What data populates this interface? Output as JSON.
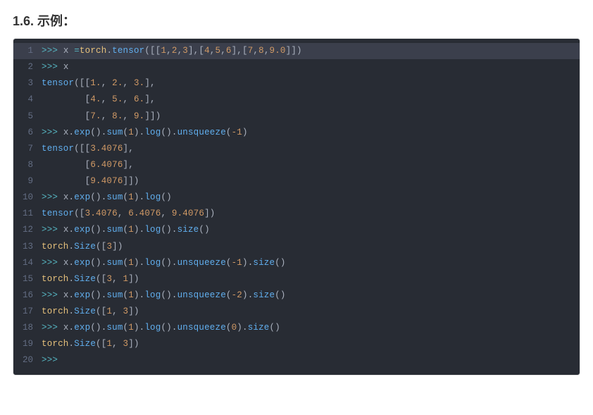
{
  "heading": "1.6. 示例：",
  "code": {
    "lineNumbers": [
      "1",
      "2",
      "3",
      "4",
      "5",
      "6",
      "7",
      "8",
      "9",
      "10",
      "11",
      "12",
      "13",
      "14",
      "15",
      "16",
      "17",
      "18",
      "19",
      "20"
    ],
    "lines": [
      {
        "highlight": true,
        "tokens": [
          [
            ">>> ",
            "t-op"
          ],
          [
            "x ",
            "t-id"
          ],
          [
            "=",
            "t-op"
          ],
          [
            "torch",
            "t-obj"
          ],
          [
            ".",
            "t-punc"
          ],
          [
            "tensor",
            "t-meth"
          ],
          [
            "([[",
            "t-punc"
          ],
          [
            "1",
            "t-num"
          ],
          [
            ",",
            "t-punc"
          ],
          [
            "2",
            "t-num"
          ],
          [
            ",",
            "t-punc"
          ],
          [
            "3",
            "t-num"
          ],
          [
            "],[",
            "t-punc"
          ],
          [
            "4",
            "t-num"
          ],
          [
            ",",
            "t-punc"
          ],
          [
            "5",
            "t-num"
          ],
          [
            ",",
            "t-punc"
          ],
          [
            "6",
            "t-num"
          ],
          [
            "],[",
            "t-punc"
          ],
          [
            "7",
            "t-num"
          ],
          [
            ",",
            "t-punc"
          ],
          [
            "8",
            "t-num"
          ],
          [
            ",",
            "t-punc"
          ],
          [
            "9.0",
            "t-num"
          ],
          [
            "]])",
            "t-punc"
          ]
        ]
      },
      {
        "highlight": false,
        "tokens": [
          [
            ">>> ",
            "t-op"
          ],
          [
            "x",
            "t-id"
          ]
        ]
      },
      {
        "highlight": false,
        "tokens": [
          [
            "tensor",
            "t-meth"
          ],
          [
            "([[",
            "t-punc"
          ],
          [
            "1.",
            "t-num"
          ],
          [
            ", ",
            "t-punc"
          ],
          [
            "2.",
            "t-num"
          ],
          [
            ", ",
            "t-punc"
          ],
          [
            "3.",
            "t-num"
          ],
          [
            "],",
            "t-punc"
          ]
        ]
      },
      {
        "highlight": false,
        "tokens": [
          [
            "        [",
            "t-punc"
          ],
          [
            "4.",
            "t-num"
          ],
          [
            ", ",
            "t-punc"
          ],
          [
            "5.",
            "t-num"
          ],
          [
            ", ",
            "t-punc"
          ],
          [
            "6.",
            "t-num"
          ],
          [
            "],",
            "t-punc"
          ]
        ]
      },
      {
        "highlight": false,
        "tokens": [
          [
            "        [",
            "t-punc"
          ],
          [
            "7.",
            "t-num"
          ],
          [
            ", ",
            "t-punc"
          ],
          [
            "8.",
            "t-num"
          ],
          [
            ", ",
            "t-punc"
          ],
          [
            "9.",
            "t-num"
          ],
          [
            "]])",
            "t-punc"
          ]
        ]
      },
      {
        "highlight": false,
        "tokens": [
          [
            ">>> ",
            "t-op"
          ],
          [
            "x",
            "t-id"
          ],
          [
            ".",
            "t-punc"
          ],
          [
            "exp",
            "t-meth"
          ],
          [
            "().",
            "t-punc"
          ],
          [
            "sum",
            "t-meth"
          ],
          [
            "(",
            "t-punc"
          ],
          [
            "1",
            "t-num"
          ],
          [
            ").",
            "t-punc"
          ],
          [
            "log",
            "t-meth"
          ],
          [
            "().",
            "t-punc"
          ],
          [
            "unsqueeze",
            "t-meth"
          ],
          [
            "(",
            "t-punc"
          ],
          [
            "-1",
            "t-num"
          ],
          [
            ")",
            "t-punc"
          ]
        ]
      },
      {
        "highlight": false,
        "tokens": [
          [
            "tensor",
            "t-meth"
          ],
          [
            "([[",
            "t-punc"
          ],
          [
            "3.4076",
            "t-num"
          ],
          [
            "],",
            "t-punc"
          ]
        ]
      },
      {
        "highlight": false,
        "tokens": [
          [
            "        [",
            "t-punc"
          ],
          [
            "6.4076",
            "t-num"
          ],
          [
            "],",
            "t-punc"
          ]
        ]
      },
      {
        "highlight": false,
        "tokens": [
          [
            "        [",
            "t-punc"
          ],
          [
            "9.4076",
            "t-num"
          ],
          [
            "]])",
            "t-punc"
          ]
        ]
      },
      {
        "highlight": false,
        "tokens": [
          [
            ">>> ",
            "t-op"
          ],
          [
            "x",
            "t-id"
          ],
          [
            ".",
            "t-punc"
          ],
          [
            "exp",
            "t-meth"
          ],
          [
            "().",
            "t-punc"
          ],
          [
            "sum",
            "t-meth"
          ],
          [
            "(",
            "t-punc"
          ],
          [
            "1",
            "t-num"
          ],
          [
            ").",
            "t-punc"
          ],
          [
            "log",
            "t-meth"
          ],
          [
            "()",
            "t-punc"
          ]
        ]
      },
      {
        "highlight": false,
        "tokens": [
          [
            "tensor",
            "t-meth"
          ],
          [
            "([",
            "t-punc"
          ],
          [
            "3.4076",
            "t-num"
          ],
          [
            ", ",
            "t-punc"
          ],
          [
            "6.4076",
            "t-num"
          ],
          [
            ", ",
            "t-punc"
          ],
          [
            "9.4076",
            "t-num"
          ],
          [
            "])",
            "t-punc"
          ]
        ]
      },
      {
        "highlight": false,
        "tokens": [
          [
            ">>> ",
            "t-op"
          ],
          [
            "x",
            "t-id"
          ],
          [
            ".",
            "t-punc"
          ],
          [
            "exp",
            "t-meth"
          ],
          [
            "().",
            "t-punc"
          ],
          [
            "sum",
            "t-meth"
          ],
          [
            "(",
            "t-punc"
          ],
          [
            "1",
            "t-num"
          ],
          [
            ").",
            "t-punc"
          ],
          [
            "log",
            "t-meth"
          ],
          [
            "().",
            "t-punc"
          ],
          [
            "size",
            "t-meth"
          ],
          [
            "()",
            "t-punc"
          ]
        ]
      },
      {
        "highlight": false,
        "tokens": [
          [
            "torch",
            "t-obj"
          ],
          [
            ".",
            "t-punc"
          ],
          [
            "Size",
            "t-meth"
          ],
          [
            "([",
            "t-punc"
          ],
          [
            "3",
            "t-num"
          ],
          [
            "])",
            "t-punc"
          ]
        ]
      },
      {
        "highlight": false,
        "tokens": [
          [
            ">>> ",
            "t-op"
          ],
          [
            "x",
            "t-id"
          ],
          [
            ".",
            "t-punc"
          ],
          [
            "exp",
            "t-meth"
          ],
          [
            "().",
            "t-punc"
          ],
          [
            "sum",
            "t-meth"
          ],
          [
            "(",
            "t-punc"
          ],
          [
            "1",
            "t-num"
          ],
          [
            ").",
            "t-punc"
          ],
          [
            "log",
            "t-meth"
          ],
          [
            "().",
            "t-punc"
          ],
          [
            "unsqueeze",
            "t-meth"
          ],
          [
            "(",
            "t-punc"
          ],
          [
            "-1",
            "t-num"
          ],
          [
            ").",
            "t-punc"
          ],
          [
            "size",
            "t-meth"
          ],
          [
            "()",
            "t-punc"
          ]
        ]
      },
      {
        "highlight": false,
        "tokens": [
          [
            "torch",
            "t-obj"
          ],
          [
            ".",
            "t-punc"
          ],
          [
            "Size",
            "t-meth"
          ],
          [
            "([",
            "t-punc"
          ],
          [
            "3",
            "t-num"
          ],
          [
            ", ",
            "t-punc"
          ],
          [
            "1",
            "t-num"
          ],
          [
            "])",
            "t-punc"
          ]
        ]
      },
      {
        "highlight": false,
        "tokens": [
          [
            ">>> ",
            "t-op"
          ],
          [
            "x",
            "t-id"
          ],
          [
            ".",
            "t-punc"
          ],
          [
            "exp",
            "t-meth"
          ],
          [
            "().",
            "t-punc"
          ],
          [
            "sum",
            "t-meth"
          ],
          [
            "(",
            "t-punc"
          ],
          [
            "1",
            "t-num"
          ],
          [
            ").",
            "t-punc"
          ],
          [
            "log",
            "t-meth"
          ],
          [
            "().",
            "t-punc"
          ],
          [
            "unsqueeze",
            "t-meth"
          ],
          [
            "(",
            "t-punc"
          ],
          [
            "-2",
            "t-num"
          ],
          [
            ").",
            "t-punc"
          ],
          [
            "size",
            "t-meth"
          ],
          [
            "()",
            "t-punc"
          ]
        ]
      },
      {
        "highlight": false,
        "tokens": [
          [
            "torch",
            "t-obj"
          ],
          [
            ".",
            "t-punc"
          ],
          [
            "Size",
            "t-meth"
          ],
          [
            "([",
            "t-punc"
          ],
          [
            "1",
            "t-num"
          ],
          [
            ", ",
            "t-punc"
          ],
          [
            "3",
            "t-num"
          ],
          [
            "])",
            "t-punc"
          ]
        ]
      },
      {
        "highlight": false,
        "tokens": [
          [
            ">>> ",
            "t-op"
          ],
          [
            "x",
            "t-id"
          ],
          [
            ".",
            "t-punc"
          ],
          [
            "exp",
            "t-meth"
          ],
          [
            "().",
            "t-punc"
          ],
          [
            "sum",
            "t-meth"
          ],
          [
            "(",
            "t-punc"
          ],
          [
            "1",
            "t-num"
          ],
          [
            ").",
            "t-punc"
          ],
          [
            "log",
            "t-meth"
          ],
          [
            "().",
            "t-punc"
          ],
          [
            "unsqueeze",
            "t-meth"
          ],
          [
            "(",
            "t-punc"
          ],
          [
            "0",
            "t-num"
          ],
          [
            ").",
            "t-punc"
          ],
          [
            "size",
            "t-meth"
          ],
          [
            "()",
            "t-punc"
          ]
        ]
      },
      {
        "highlight": false,
        "tokens": [
          [
            "torch",
            "t-obj"
          ],
          [
            ".",
            "t-punc"
          ],
          [
            "Size",
            "t-meth"
          ],
          [
            "([",
            "t-punc"
          ],
          [
            "1",
            "t-num"
          ],
          [
            ", ",
            "t-punc"
          ],
          [
            "3",
            "t-num"
          ],
          [
            "])",
            "t-punc"
          ]
        ]
      },
      {
        "highlight": false,
        "tokens": [
          [
            ">>>",
            "t-op"
          ]
        ]
      }
    ]
  }
}
